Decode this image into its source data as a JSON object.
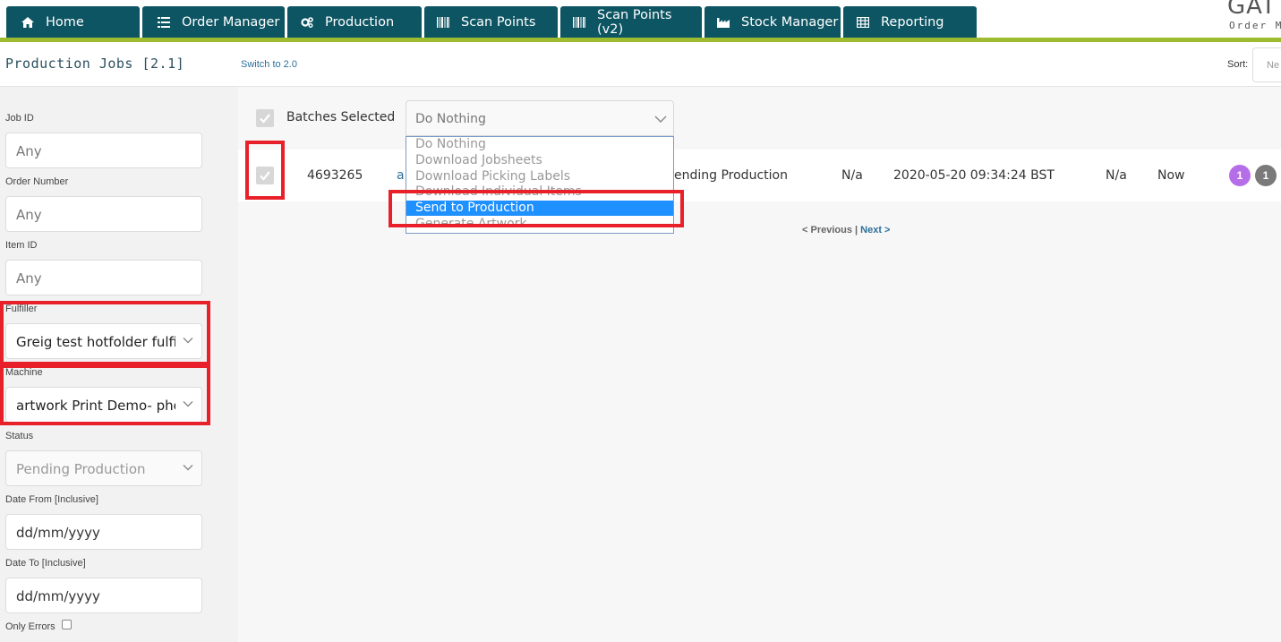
{
  "nav": {
    "tabs": [
      {
        "label": "Home",
        "icon": "home-icon"
      },
      {
        "label": "Order Manager",
        "icon": "list-icon"
      },
      {
        "label": "Production",
        "icon": "gears-icon"
      },
      {
        "label": "Scan Points",
        "icon": "barcode-icon"
      },
      {
        "label": "Scan Points (v2)",
        "icon": "barcode-icon"
      },
      {
        "label": "Stock Manager",
        "icon": "factory-icon"
      },
      {
        "label": "Reporting",
        "icon": "table-icon"
      }
    ],
    "brand_partial": "GAT",
    "brand_sub_partial": "Order M",
    "colors": {
      "nav_bg": "#0d5563",
      "accent_line": "#9dbb2e"
    }
  },
  "header": {
    "title": "Production Jobs [2.1]",
    "switch_link": "Switch to 2.0",
    "sort_label": "Sort:",
    "sort_value_partial": "Ne"
  },
  "filters": {
    "job_id": {
      "label": "Job ID",
      "placeholder": "Any"
    },
    "order_number": {
      "label": "Order Number",
      "placeholder": "Any"
    },
    "item_id": {
      "label": "Item ID",
      "placeholder": "Any"
    },
    "fulfiller": {
      "label": "Fulfiller",
      "value": "Greig test hotfolder fulfi"
    },
    "machine": {
      "label": "Machine",
      "value": "artwork Print Demo- pho"
    },
    "status": {
      "label": "Status",
      "value": "Pending Production"
    },
    "date_from": {
      "label": "Date From [Inclusive]",
      "value": "dd/mm/yyyy"
    },
    "date_to": {
      "label": "Date To [Inclusive]",
      "value": "dd/mm/yyyy"
    },
    "only_errors": {
      "label": "Only Errors",
      "checked": false
    }
  },
  "batch": {
    "label": "Batches Selected",
    "action_value": "Do Nothing",
    "options": [
      "Do Nothing",
      "Download Jobsheets",
      "Download Picking Labels",
      "Download Individual Items",
      "Send to Production",
      "Generate Artwork"
    ],
    "highlighted_option": "Send to Production"
  },
  "job_row": {
    "id": "4693265",
    "link_partial": "a",
    "status": "ending Production",
    "col_a": "N/a",
    "timestamp": "2020-05-20 09:34:24 BST",
    "col_b": "N/a",
    "due": "Now",
    "badges": [
      {
        "value": "1",
        "color": "#b66ee8"
      },
      {
        "value": "1",
        "color": "#7a7a7a"
      }
    ]
  },
  "pager": {
    "prev": "< Previous",
    "separator": "|",
    "next": "Next >"
  }
}
